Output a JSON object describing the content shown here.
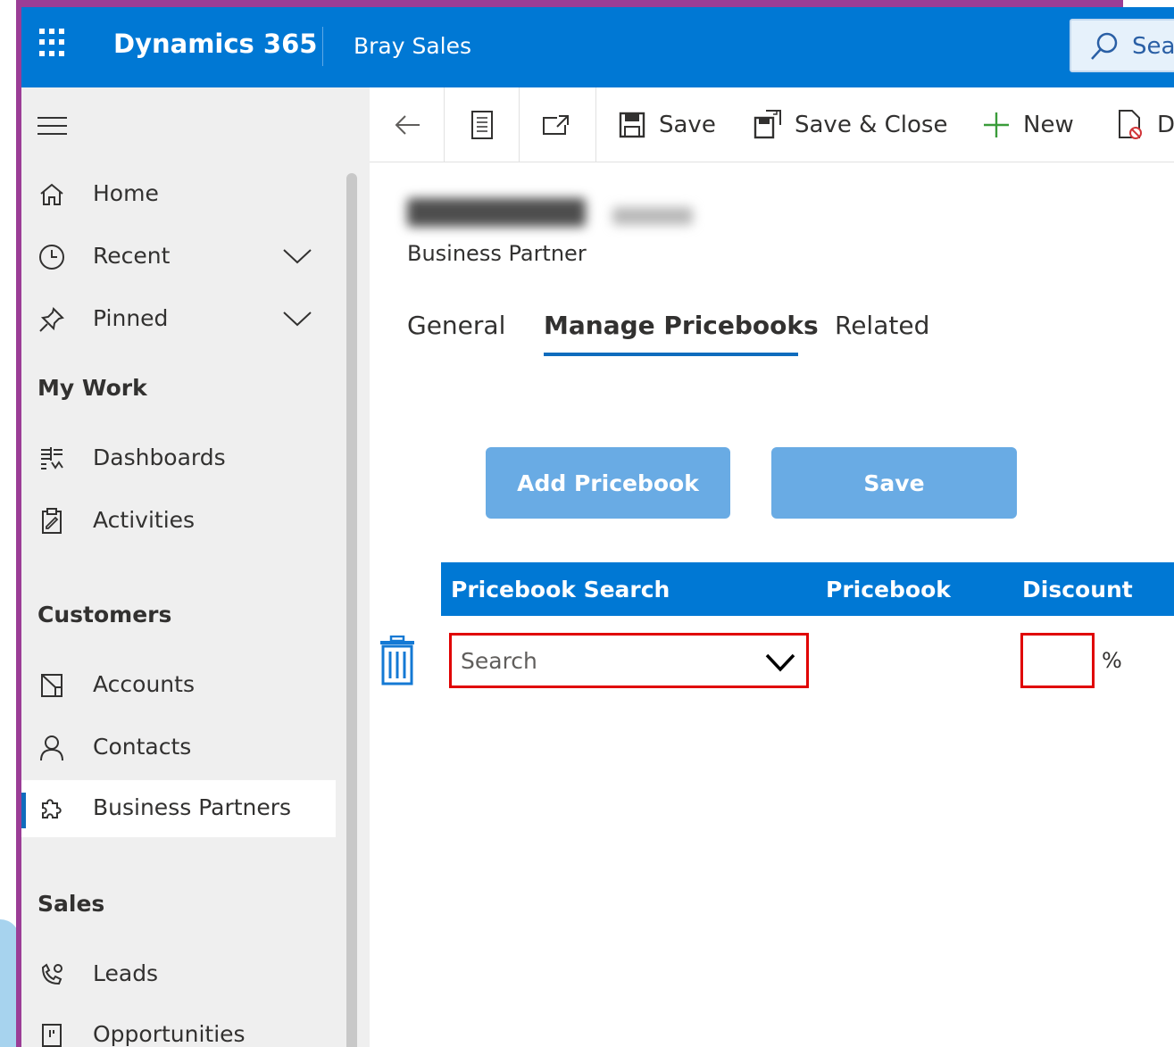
{
  "header": {
    "app_title": "Dynamics 365",
    "app_name": "Bray Sales",
    "search_text": "Sear"
  },
  "sidebar": {
    "items_top": [
      {
        "label": "Home",
        "icon": "home-icon"
      },
      {
        "label": "Recent",
        "icon": "clock-icon"
      },
      {
        "label": "Pinned",
        "icon": "pin-icon"
      }
    ],
    "sections": [
      {
        "title": "My Work",
        "items": [
          {
            "label": "Dashboards",
            "icon": "dashboard-icon"
          },
          {
            "label": "Activities",
            "icon": "clipboard-icon"
          }
        ]
      },
      {
        "title": "Customers",
        "items": [
          {
            "label": "Accounts",
            "icon": "building-icon"
          },
          {
            "label": "Contacts",
            "icon": "person-icon"
          },
          {
            "label": "Business Partners",
            "icon": "puzzle-icon",
            "active": true
          }
        ]
      },
      {
        "title": "Sales",
        "items": [
          {
            "label": "Leads",
            "icon": "phone-icon"
          },
          {
            "label": "Opportunities",
            "icon": "flag-icon"
          }
        ]
      }
    ]
  },
  "commandbar": {
    "save": "Save",
    "save_close": "Save & Close",
    "new": "New",
    "deactivate": "D"
  },
  "form": {
    "entity": "Business Partner",
    "tabs": [
      "General",
      "Manage Pricebooks",
      "Related"
    ],
    "active_tab": "Manage Pricebooks",
    "add_button": "Add Pricebook",
    "save_button": "Save",
    "grid": {
      "columns": [
        "Pricebook Search",
        "Pricebook",
        "Discount"
      ],
      "row": {
        "search_placeholder": "Search",
        "pricebook": "",
        "discount": "",
        "discount_unit": "%"
      }
    }
  },
  "colors": {
    "brand": "#0078d4",
    "frame": "#9b3d96",
    "button": "#69abe4",
    "error": "#e00000"
  }
}
